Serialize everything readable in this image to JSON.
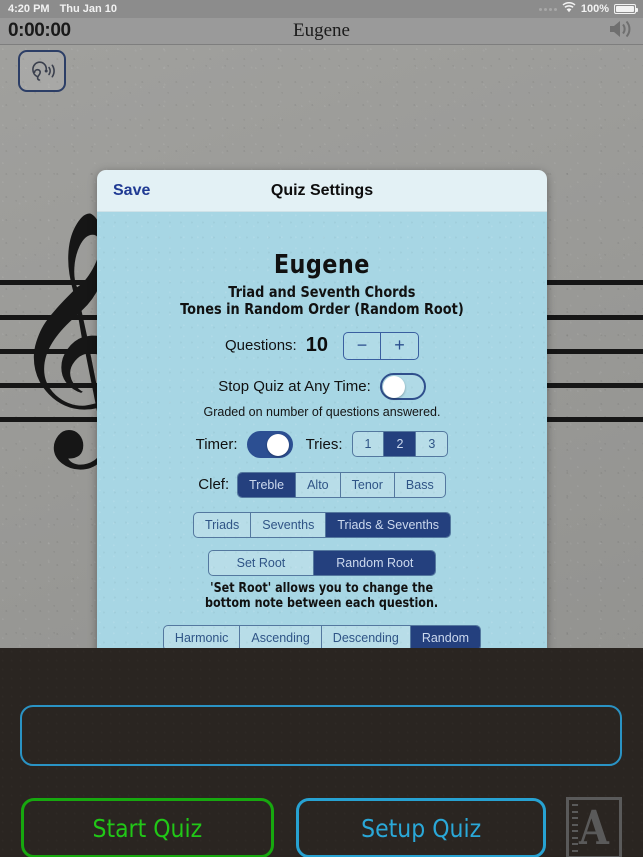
{
  "status_bar": {
    "time": "4:20 PM",
    "date": "Thu Jan 10",
    "battery_percent": "100%",
    "wifi_icon": "wifi-icon",
    "signal_icon": "signal-dots-icon",
    "battery_icon": "battery-icon"
  },
  "nav_bar": {
    "timer": "0:00:00",
    "title": "Eugene",
    "speaker_icon": "speaker-volume-icon"
  },
  "page": {
    "listen_icon": "ear-listen-icon",
    "clef_glyph": "𝄞",
    "staff_line_count": 5
  },
  "modal": {
    "save_label": "Save",
    "title": "Quiz Settings",
    "quiz_name": "Eugene",
    "subtitle_line1": "Triad and Seventh Chords",
    "subtitle_line2": "Tones in Random Order (Random Root)",
    "questions": {
      "label": "Questions:",
      "value": "10",
      "decrement_label": "−",
      "increment_label": "+"
    },
    "stop_quiz": {
      "label": "Stop Quiz at Any Time:",
      "state": "off",
      "note": "Graded on number of questions answered."
    },
    "timer": {
      "label": "Timer:",
      "state": "on"
    },
    "tries": {
      "label": "Tries:",
      "options": [
        "1",
        "2",
        "3"
      ],
      "selected": "2"
    },
    "clef": {
      "label": "Clef:",
      "options": [
        "Treble",
        "Alto",
        "Tenor",
        "Bass"
      ],
      "selected": "Treble"
    },
    "chord_type": {
      "options": [
        "Triads",
        "Sevenths",
        "Triads & Sevenths"
      ],
      "selected": "Triads & Sevenths"
    },
    "root_mode": {
      "options": [
        "Set Root",
        "Random Root"
      ],
      "selected": "Random Root",
      "note_line1": "'Set Root' allows you to change the",
      "note_line2": "bottom note between each question."
    },
    "order": {
      "options": [
        "Harmonic",
        "Ascending",
        "Descending",
        "Random"
      ],
      "selected": "Random"
    }
  },
  "bottom": {
    "answer_field_value": "",
    "answer_field_placeholder": "",
    "start_label": "Start Quiz",
    "setup_label": "Setup Quiz",
    "logo_letter": "A"
  },
  "colors": {
    "accent_blue": "#24407e",
    "start_green": "#21c717",
    "setup_blue": "#2aa8d8",
    "modal_body": "#a7d6e4",
    "modal_header": "#e3f1f5",
    "paper": "#9b9b98",
    "dark_panel": "#2a2521"
  }
}
